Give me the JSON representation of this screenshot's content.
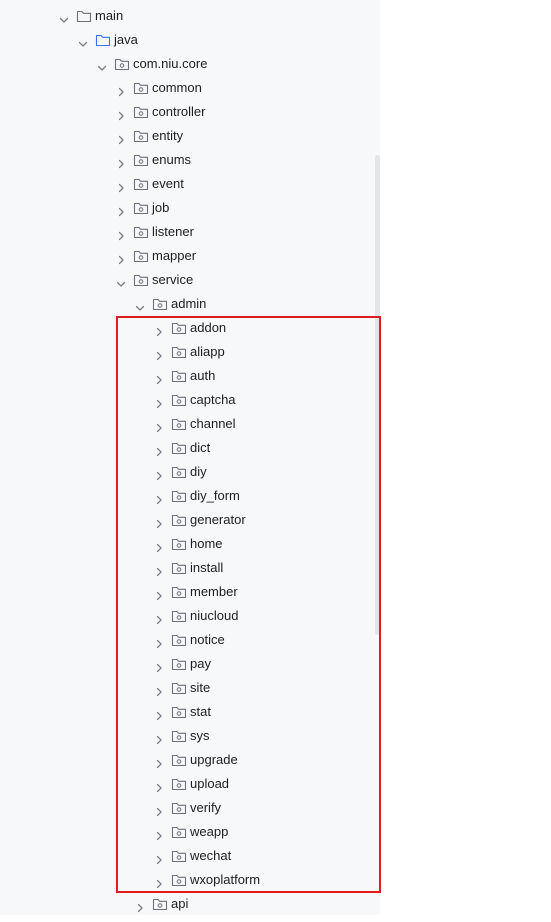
{
  "tree": {
    "colors": {
      "background": "#f7f8fa",
      "text": "#1e1e1e",
      "icon": "#6c707e",
      "selected_icon": "#3574f0",
      "highlight": "#e11b22"
    },
    "nodes": [
      {
        "label": "main",
        "depth": 0,
        "expanded": true,
        "package": false,
        "accent": false
      },
      {
        "label": "java",
        "depth": 1,
        "expanded": true,
        "package": false,
        "accent": true
      },
      {
        "label": "com.niu.core",
        "depth": 2,
        "expanded": true,
        "package": true,
        "accent": false
      },
      {
        "label": "common",
        "depth": 3,
        "expanded": false,
        "package": true,
        "accent": false
      },
      {
        "label": "controller",
        "depth": 3,
        "expanded": false,
        "package": true,
        "accent": false
      },
      {
        "label": "entity",
        "depth": 3,
        "expanded": false,
        "package": true,
        "accent": false
      },
      {
        "label": "enums",
        "depth": 3,
        "expanded": false,
        "package": true,
        "accent": false
      },
      {
        "label": "event",
        "depth": 3,
        "expanded": false,
        "package": true,
        "accent": false
      },
      {
        "label": "job",
        "depth": 3,
        "expanded": false,
        "package": true,
        "accent": false
      },
      {
        "label": "listener",
        "depth": 3,
        "expanded": false,
        "package": true,
        "accent": false
      },
      {
        "label": "mapper",
        "depth": 3,
        "expanded": false,
        "package": true,
        "accent": false
      },
      {
        "label": "service",
        "depth": 3,
        "expanded": true,
        "package": true,
        "accent": false
      },
      {
        "label": "admin",
        "depth": 4,
        "expanded": true,
        "package": true,
        "accent": false
      },
      {
        "label": "addon",
        "depth": 5,
        "expanded": false,
        "package": true,
        "accent": false
      },
      {
        "label": "aliapp",
        "depth": 5,
        "expanded": false,
        "package": true,
        "accent": false
      },
      {
        "label": "auth",
        "depth": 5,
        "expanded": false,
        "package": true,
        "accent": false
      },
      {
        "label": "captcha",
        "depth": 5,
        "expanded": false,
        "package": true,
        "accent": false
      },
      {
        "label": "channel",
        "depth": 5,
        "expanded": false,
        "package": true,
        "accent": false
      },
      {
        "label": "dict",
        "depth": 5,
        "expanded": false,
        "package": true,
        "accent": false
      },
      {
        "label": "diy",
        "depth": 5,
        "expanded": false,
        "package": true,
        "accent": false
      },
      {
        "label": "diy_form",
        "depth": 5,
        "expanded": false,
        "package": true,
        "accent": false
      },
      {
        "label": "generator",
        "depth": 5,
        "expanded": false,
        "package": true,
        "accent": false
      },
      {
        "label": "home",
        "depth": 5,
        "expanded": false,
        "package": true,
        "accent": false
      },
      {
        "label": "install",
        "depth": 5,
        "expanded": false,
        "package": true,
        "accent": false
      },
      {
        "label": "member",
        "depth": 5,
        "expanded": false,
        "package": true,
        "accent": false
      },
      {
        "label": "niucloud",
        "depth": 5,
        "expanded": false,
        "package": true,
        "accent": false
      },
      {
        "label": "notice",
        "depth": 5,
        "expanded": false,
        "package": true,
        "accent": false
      },
      {
        "label": "pay",
        "depth": 5,
        "expanded": false,
        "package": true,
        "accent": false
      },
      {
        "label": "site",
        "depth": 5,
        "expanded": false,
        "package": true,
        "accent": false
      },
      {
        "label": "stat",
        "depth": 5,
        "expanded": false,
        "package": true,
        "accent": false
      },
      {
        "label": "sys",
        "depth": 5,
        "expanded": false,
        "package": true,
        "accent": false
      },
      {
        "label": "upgrade",
        "depth": 5,
        "expanded": false,
        "package": true,
        "accent": false
      },
      {
        "label": "upload",
        "depth": 5,
        "expanded": false,
        "package": true,
        "accent": false
      },
      {
        "label": "verify",
        "depth": 5,
        "expanded": false,
        "package": true,
        "accent": false
      },
      {
        "label": "weapp",
        "depth": 5,
        "expanded": false,
        "package": true,
        "accent": false
      },
      {
        "label": "wechat",
        "depth": 5,
        "expanded": false,
        "package": true,
        "accent": false
      },
      {
        "label": "wxoplatform",
        "depth": 5,
        "expanded": false,
        "package": true,
        "accent": false
      },
      {
        "label": "api",
        "depth": 4,
        "expanded": false,
        "package": true,
        "accent": false
      }
    ]
  }
}
